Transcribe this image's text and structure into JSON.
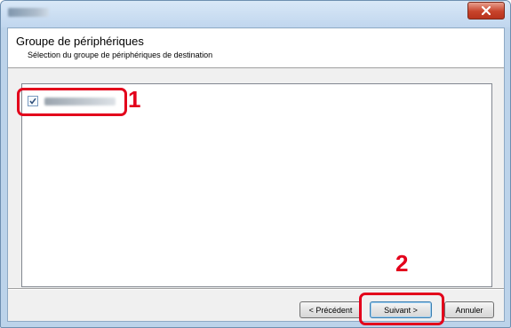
{
  "window": {
    "close_glyph": "×"
  },
  "header": {
    "title": "Groupe de périphériques",
    "subtitle": "Sélection du groupe de périphériques de destination"
  },
  "device_list": {
    "items": [
      {
        "label": "",
        "checked": true,
        "check_glyph": "✓"
      }
    ]
  },
  "annotations": {
    "step1": "1",
    "step2": "2",
    "highlight_color": "#e3001b"
  },
  "buttons": {
    "back": "< Précédent",
    "next": "Suivant >",
    "cancel": "Annuler"
  }
}
